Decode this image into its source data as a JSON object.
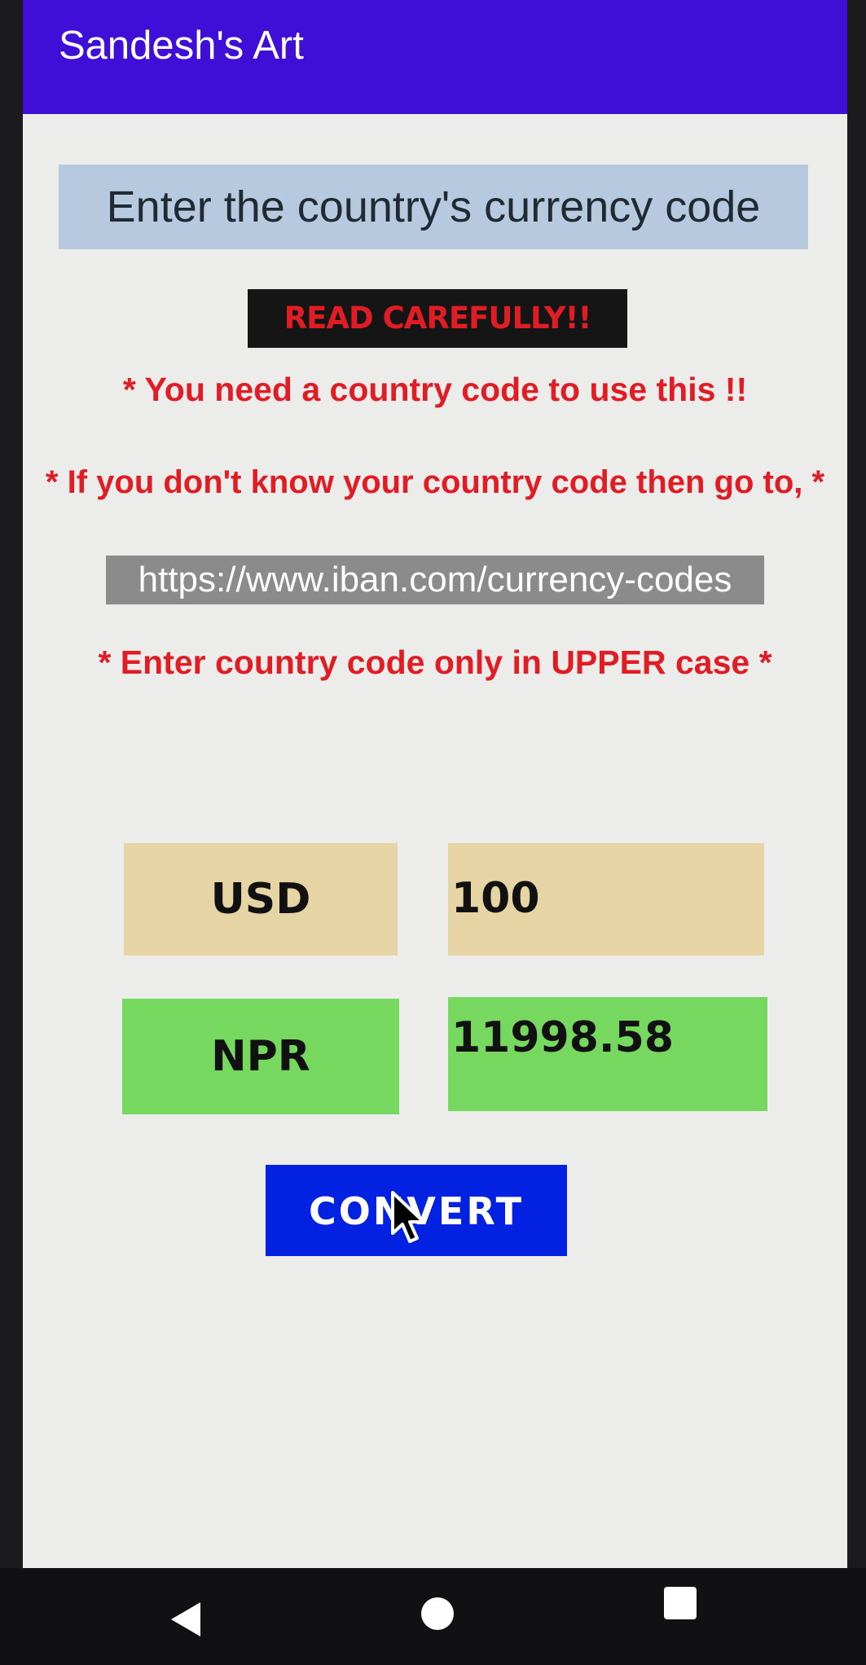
{
  "app_bar": {
    "title": "Sandesh's Art"
  },
  "heading": "Enter the country's currency code",
  "warning_badge": "READ CAREFULLY!!",
  "notes": {
    "need_code": "* You need a country code to use this !!",
    "dont_know": "* If you don't know your country code then go to, *",
    "upper_case": "* Enter country code only in UPPER case *"
  },
  "link": {
    "url": "https://www.iban.com/currency-codes"
  },
  "converter": {
    "from_code": "USD",
    "from_amount": "100",
    "to_code": "NPR",
    "to_amount": "11998.58"
  },
  "convert_button": {
    "label": "CONVERT"
  },
  "colors": {
    "app_bar": "#3f0fd8",
    "warning_text": "#e01c24",
    "from_row": "#e6d4a4",
    "to_row": "#77d860",
    "button": "#0321e0"
  },
  "icons": {
    "nav_back": "back-triangle-icon",
    "nav_home": "home-circle-icon",
    "nav_recent": "recents-square-icon",
    "pointer": "mouse-pointer-icon"
  }
}
